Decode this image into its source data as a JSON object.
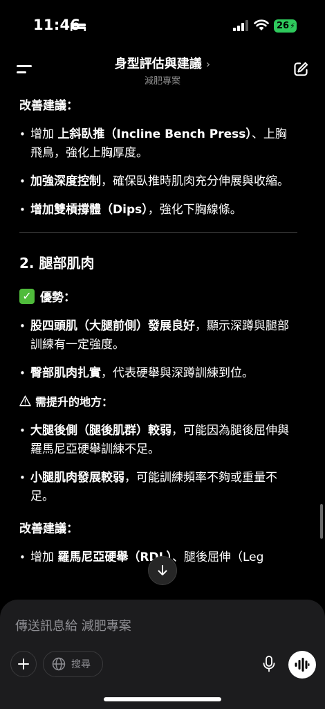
{
  "status_bar": {
    "time": "11:46",
    "battery": "26"
  },
  "header": {
    "title": "身型評估與建議",
    "chevron": "›",
    "subtitle": "減肥專案"
  },
  "content": {
    "improve_label_1": "改善建議：",
    "improve_items_1": [
      {
        "pre": "增加 ",
        "bold": "上斜臥推（Incline Bench Press）",
        "post": "、上胸飛鳥，強化上胸厚度。"
      },
      {
        "pre": "",
        "bold": "加強深度控制",
        "post": "，確保臥推時肌肉充分伸展與收縮。"
      },
      {
        "pre": "",
        "bold": "增加雙槓撐體（Dips）",
        "post": "，強化下胸線條。"
      }
    ],
    "section_title": "2. 腿部肌肉",
    "advantages_label": "優勢：",
    "advantages_items": [
      {
        "bold": "股四頭肌（大腿前側）發展良好",
        "post": "，顯示深蹲與腿部訓練有一定強度。"
      },
      {
        "bold": "臀部肌肉扎實",
        "post": "，代表硬舉與深蹲訓練到位。"
      }
    ],
    "improve_needed_label": "需提升的地方：",
    "improve_needed_items": [
      {
        "bold": "大腿後側（腿後肌群）較弱",
        "post": "，可能因為腿後屈伸與羅馬尼亞硬舉訓練不足。"
      },
      {
        "bold": "小腿肌肉發展較弱",
        "post": "，可能訓練頻率不夠或重量不足。"
      }
    ],
    "improve_label_2": "改善建議：",
    "improve_items_2_partial": {
      "pre": "增加 ",
      "bold": "羅馬尼亞硬舉（RDL）",
      "post": "、腿後屈伸（Leg"
    }
  },
  "composer": {
    "placeholder": "傳送訊息給 減肥專案",
    "search_label": "搜尋"
  }
}
